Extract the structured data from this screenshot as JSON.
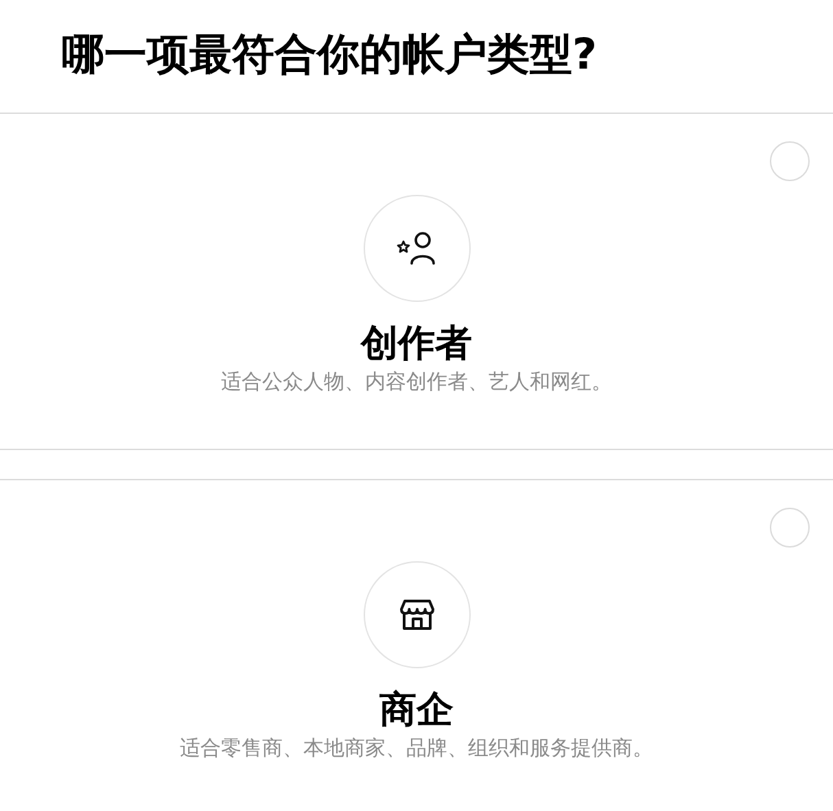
{
  "heading": "哪一项最符合你的帐户类型?",
  "options": [
    {
      "kind": "creator",
      "title": "创作者",
      "description": "适合公众人物、内容创作者、艺人和网红。",
      "selected": false
    },
    {
      "kind": "store",
      "title": "商企",
      "description": "适合零售商、本地商家、品牌、组织和服务提供商。",
      "selected": false
    }
  ]
}
